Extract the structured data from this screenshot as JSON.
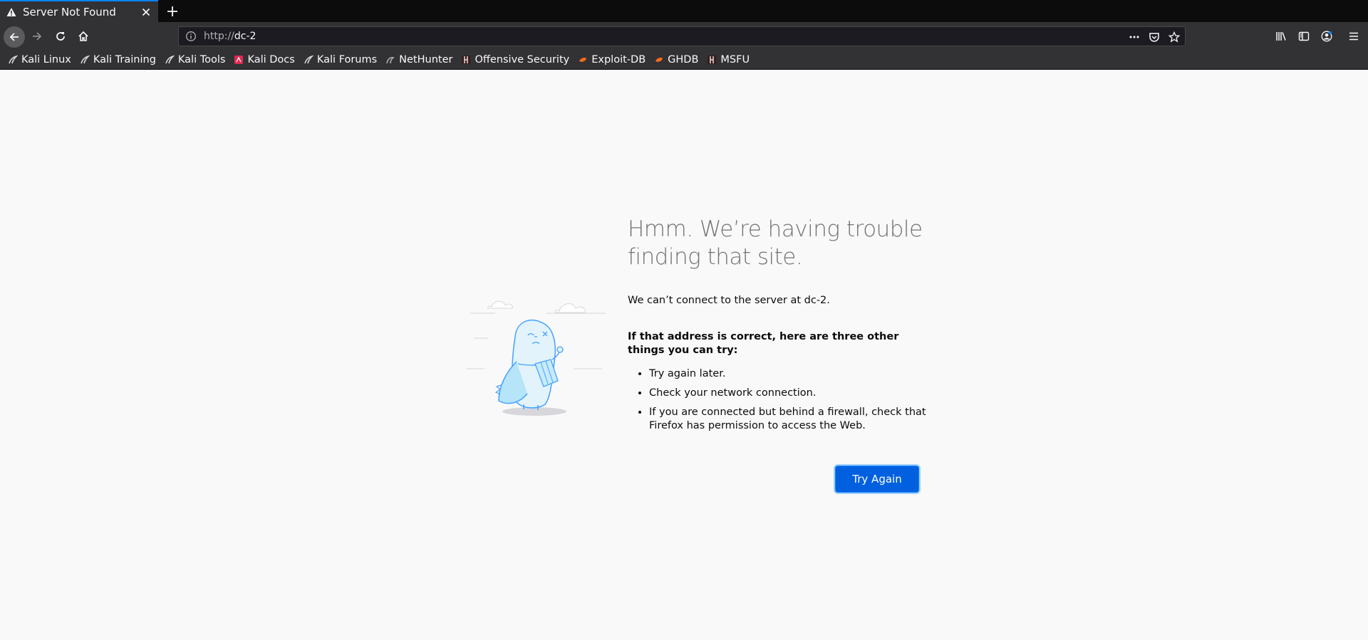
{
  "tab": {
    "title": "Server Not Found"
  },
  "url": {
    "scheme": "http://",
    "host": "dc-2"
  },
  "bookmarks": [
    {
      "label": "Kali Linux",
      "icon": "kali-dragon-icon"
    },
    {
      "label": "Kali Training",
      "icon": "kali-dragon-icon"
    },
    {
      "label": "Kali Tools",
      "icon": "kali-dragon-icon"
    },
    {
      "label": "Kali Docs",
      "icon": "kali-docs-icon"
    },
    {
      "label": "Kali Forums",
      "icon": "kali-dragon-icon"
    },
    {
      "label": "NetHunter",
      "icon": "nethunter-icon"
    },
    {
      "label": "Offensive Security",
      "icon": "offsec-icon"
    },
    {
      "label": "Exploit-DB",
      "icon": "exploitdb-icon"
    },
    {
      "label": "GHDB",
      "icon": "exploitdb-icon"
    },
    {
      "label": "MSFU",
      "icon": "offsec-icon"
    }
  ],
  "error": {
    "headline": "Hmm. We’re having trouble finding that site.",
    "description": "We can’t connect to the server at dc-2.",
    "suggestions_title": "If that address is correct, here are three other things you can try:",
    "suggestions": [
      "Try again later.",
      "Check your network connection.",
      "If you are connected but behind a firewall, check that Firefox has permission to access the Web."
    ],
    "button_label": "Try Again"
  },
  "colors": {
    "accent": "#0a84ff",
    "button": "#0060df",
    "chrome": "#323234",
    "page_background": "#f9f9fa"
  }
}
